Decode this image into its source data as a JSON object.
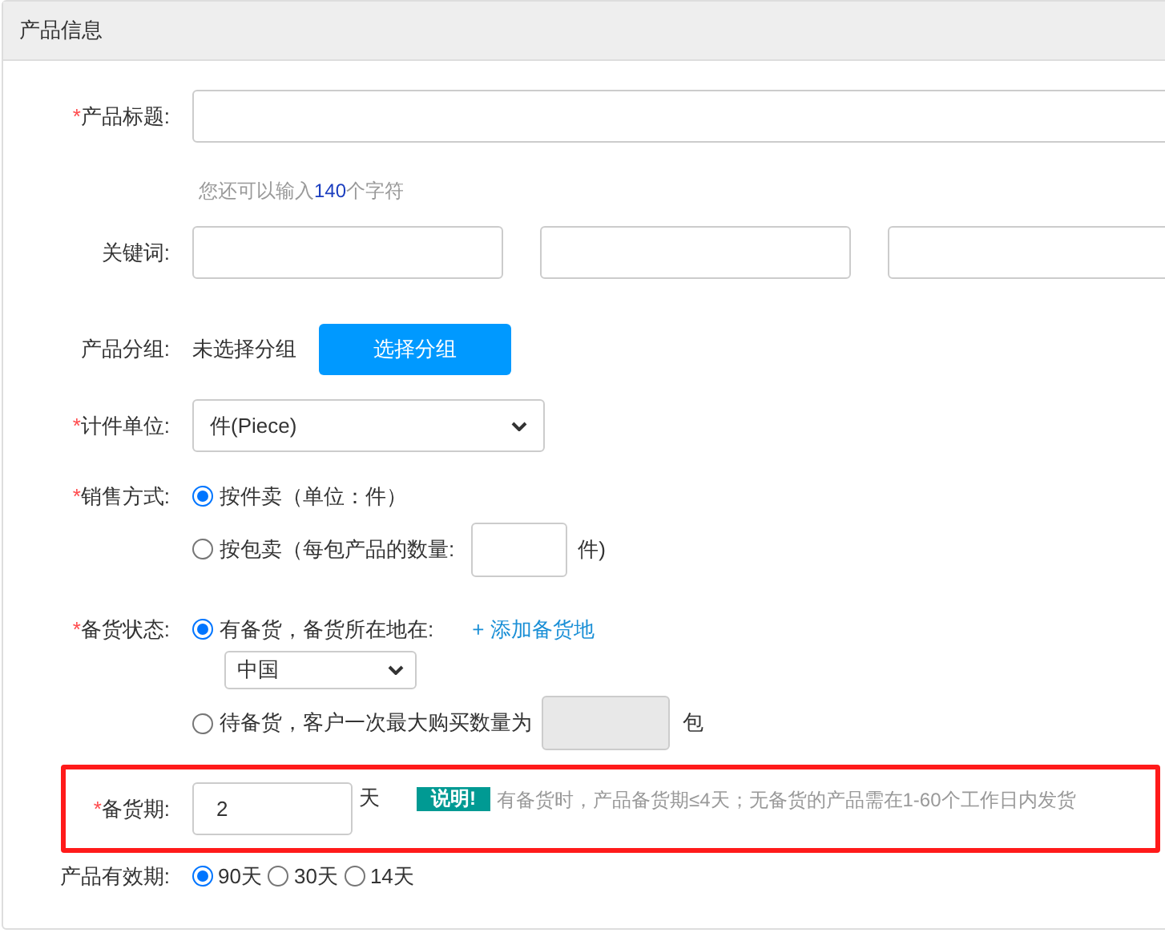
{
  "section_title": "产品信息",
  "fields": [
    {
      "kind": "text",
      "label": "产品标题:",
      "required_mark": "*",
      "hint_before": "您还可以输入",
      "hint_count": "140",
      "hint_after": "个字符"
    },
    {
      "kind": "keywords",
      "label": "关键词:"
    },
    {
      "kind": "group",
      "label": "产品分组:",
      "value": "未选择分组",
      "button": "选择分组"
    },
    {
      "kind": "select",
      "label": "计件单位:",
      "required_mark": "*",
      "value": "件(Piece)"
    },
    {
      "kind": "sale",
      "label": "销售方式:",
      "required_mark": "*",
      "options": [
        {
          "label": "按件卖（单位：件）",
          "selected": true
        },
        {
          "label": "按包卖（每包产品的数量:",
          "suffix": "件)",
          "selected": false
        }
      ]
    },
    {
      "kind": "stock",
      "label": "备货状态:",
      "required_mark": "*",
      "options": [
        {
          "label": "有备货，备货所在地在:",
          "link": "+ 添加备货地",
          "location": "中国",
          "selected": true
        },
        {
          "label": "待备货，客户一次最大购买数量为",
          "suffix": "包",
          "selected": false
        }
      ]
    },
    {
      "kind": "leadtime",
      "label": "备货期:",
      "required_mark": "*",
      "highlighted": true,
      "value": "2",
      "unit": "天",
      "badge": "说明!",
      "note": "有备货时，产品备货期≤4天；无备货的产品需在1-60个工作日内发货"
    },
    {
      "kind": "validity",
      "label": "产品有效期:",
      "options": [
        {
          "label": "90天",
          "selected": true
        },
        {
          "label": "30天",
          "selected": false
        },
        {
          "label": "14天",
          "selected": false
        }
      ]
    }
  ]
}
